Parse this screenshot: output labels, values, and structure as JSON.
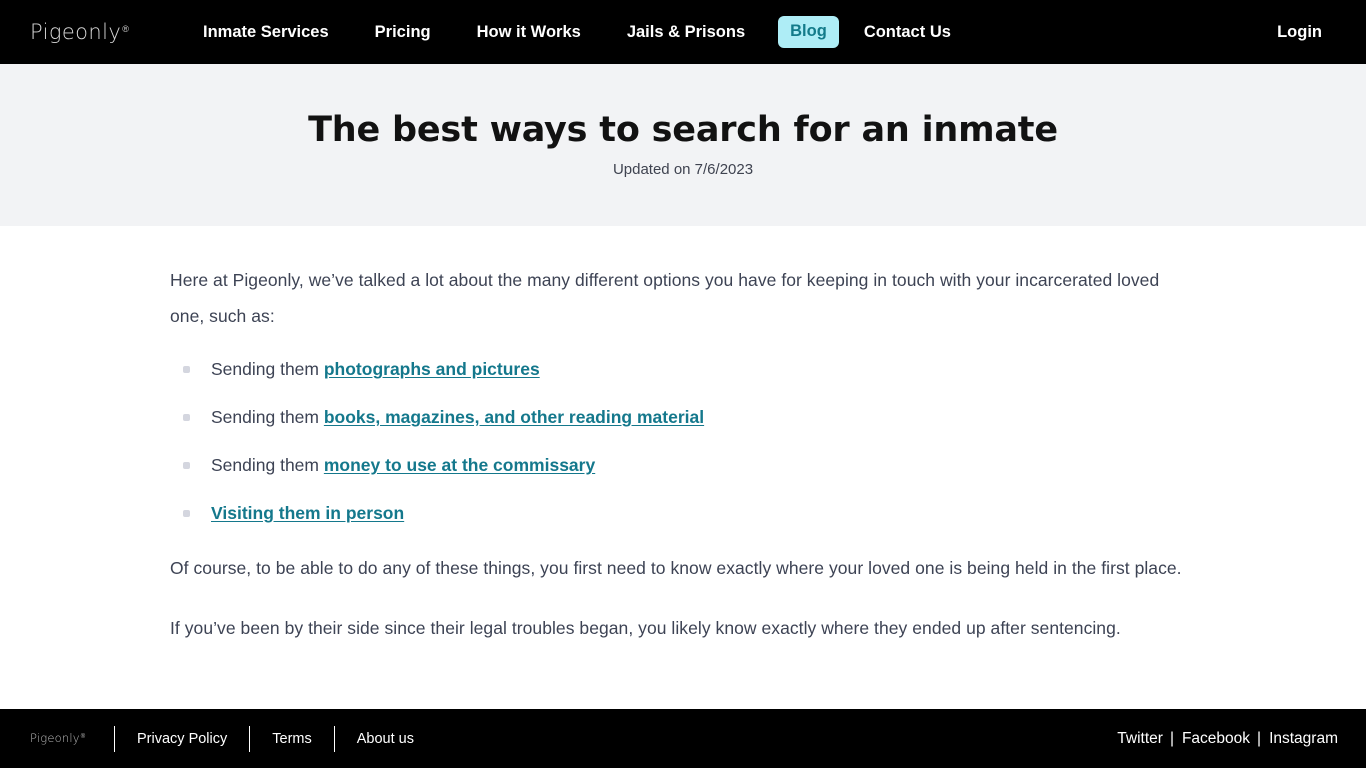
{
  "header": {
    "brand": {
      "word": "Pigeonly",
      "mark": "®"
    },
    "nav_items": [
      {
        "label": "Inmate Services",
        "active": false
      },
      {
        "label": "Pricing",
        "active": false
      },
      {
        "label": "How it Works",
        "active": false
      },
      {
        "label": "Jails & Prisons",
        "active": false
      },
      {
        "label": "Blog",
        "active": true
      },
      {
        "label": "Contact Us",
        "active": false
      }
    ],
    "login_label": "Login",
    "active_bg_color": "#aeedf6",
    "active_text_color": "#137b8a",
    "bar_color": "#000000"
  },
  "hero": {
    "title": "The best ways to search for an inmate",
    "updated": "Updated on 7/6/2023",
    "bg_color": "#f2f3f5"
  },
  "article": {
    "intro_paragraph": "Here at Pigeonly, we’ve talked a lot about the many different options you have for keeping in touch with your incarcerated loved one, such as:",
    "bullets": [
      {
        "prefix": "Sending them ",
        "link": "photographs and pictures"
      },
      {
        "prefix": "Sending them ",
        "link": "books, magazines, and other reading material"
      },
      {
        "prefix": "Sending them ",
        "link": "money to use at the commissary"
      },
      {
        "prefix": "",
        "link": "Visiting them in person"
      }
    ],
    "paragraph_2": "Of course, to be able to do any of these things, you first need to know exactly where your loved one is being held in the first place.",
    "paragraph_3": "If you’ve been by their side since their legal troubles began, you likely know exactly where they ended up after sentencing.",
    "link_color": "#14788c",
    "text_color": "#3d4354"
  },
  "footer": {
    "brand": {
      "word": "Pigeonly",
      "mark": "®"
    },
    "links": [
      {
        "label": "Privacy Policy"
      },
      {
        "label": "Terms"
      },
      {
        "label": "About us"
      }
    ],
    "social": [
      {
        "label": "Twitter"
      },
      {
        "label": "Facebook"
      },
      {
        "label": "Instagram"
      }
    ],
    "separator": "|",
    "bg_color": "#000000"
  }
}
